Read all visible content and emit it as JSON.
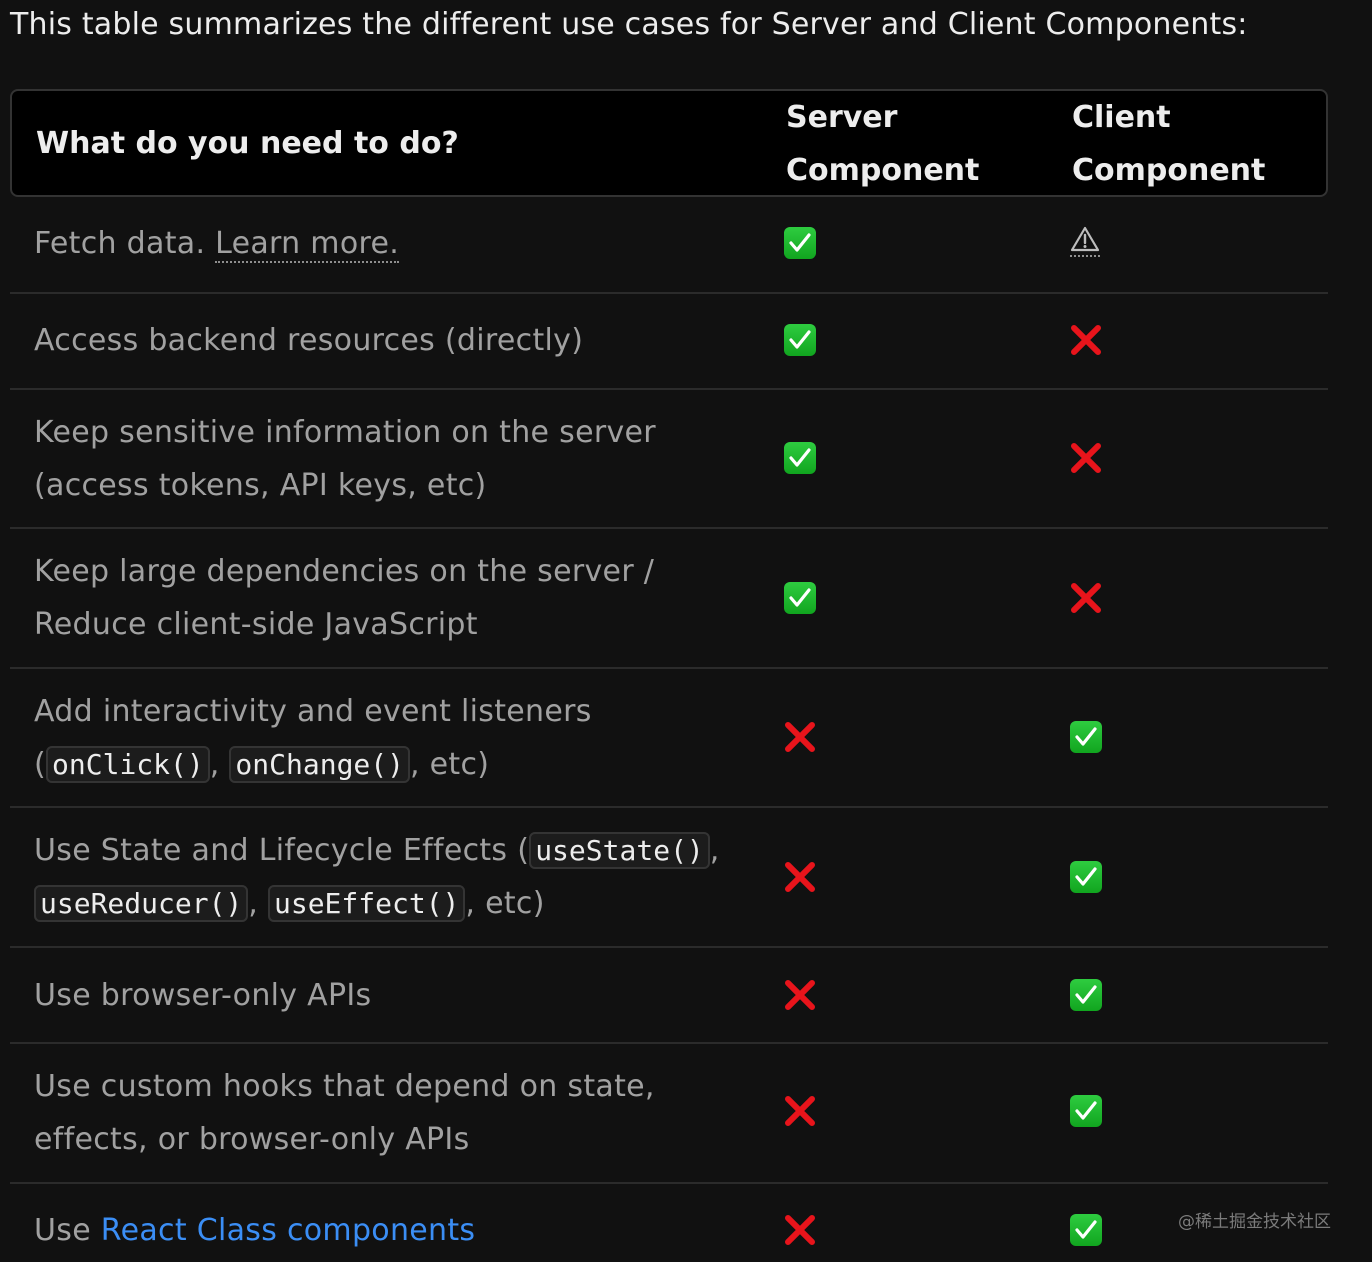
{
  "intro": "This table summarizes the different use cases for Server and Client Components:",
  "header": {
    "need": "What do you need to do?",
    "server_line1": "Server",
    "server_line2": "Component",
    "client_line1": "Client",
    "client_line2": "Component"
  },
  "rows": [
    {
      "pre": "Fetch data. ",
      "link": "Learn more.",
      "server": "check",
      "client": "warning"
    },
    {
      "text": "Access backend resources (directly)",
      "server": "check",
      "client": "cross"
    },
    {
      "line1": "Keep sensitive information on the server",
      "line2": "(access tokens, API keys, etc)",
      "server": "check",
      "client": "cross"
    },
    {
      "line1": "Keep large dependencies on the server /",
      "line2": "Reduce client-side JavaScript",
      "server": "check",
      "client": "cross"
    },
    {
      "line1": "Add interactivity and event listeners",
      "open": "(",
      "code1": "onClick()",
      "sep": ", ",
      "code2": "onChange()",
      "tail": ", etc)",
      "server": "cross",
      "client": "check"
    },
    {
      "pre": "Use State and Lifecycle Effects (",
      "code1": "useState()",
      "comma": ",",
      "code2": "useReducer()",
      "sep": ", ",
      "code3": "useEffect()",
      "tail": ", etc)",
      "server": "cross",
      "client": "check"
    },
    {
      "text": "Use browser-only APIs",
      "server": "cross",
      "client": "check"
    },
    {
      "line1": "Use custom hooks that depend on state,",
      "line2": "effects, or browser-only APIs",
      "server": "cross",
      "client": "check"
    },
    {
      "pre": "Use ",
      "link": "React Class components",
      "server": "cross",
      "client": "check"
    }
  ],
  "watermark": "@稀土掘金技术社区",
  "colors": {
    "check": "#11a51f",
    "cross": "#e8141b",
    "link": "#3b8ef5"
  }
}
